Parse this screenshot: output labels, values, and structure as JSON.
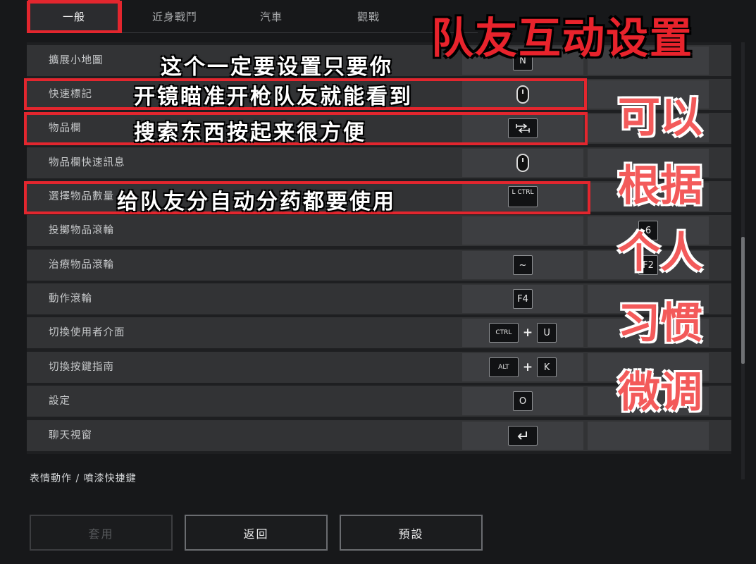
{
  "tabs": [
    {
      "label": "一般",
      "active": true
    },
    {
      "label": "近身戰鬥",
      "active": false
    },
    {
      "label": "汽車",
      "active": false
    },
    {
      "label": "觀戰",
      "active": false
    }
  ],
  "rows": [
    {
      "label": "擴展小地圖",
      "primary": "N"
    },
    {
      "label": "快速標記",
      "primary": "mouse-middle-icon"
    },
    {
      "label": "物品欄",
      "primary": "tab-key-icon"
    },
    {
      "label": "物品欄快速訊息",
      "primary": "mouse-icon"
    },
    {
      "label": "選擇物品數量",
      "primary": "L CTRL"
    },
    {
      "label": "投擲物品滾輪",
      "secondary": "6"
    },
    {
      "label": "治療物品滾輪",
      "primary": "~",
      "secondary": "F2"
    },
    {
      "label": "動作滾輪",
      "primary": "F4"
    },
    {
      "label": "切換使用者介面",
      "primary": [
        "CTRL",
        "U"
      ]
    },
    {
      "label": "切換按鍵指南",
      "primary": [
        "ALT",
        "K"
      ]
    },
    {
      "label": "設定",
      "primary": "O"
    },
    {
      "label": "聊天視窗",
      "primary": "enter-key-icon"
    }
  ],
  "keys": {
    "n": "N",
    "lctrl": "L CTRL",
    "six": "6",
    "tilde": "~",
    "f2": "F2",
    "f4": "F4",
    "ctrl": "CTRL",
    "u": "U",
    "alt": "ALT",
    "k": "K",
    "o": "O",
    "plus": "+"
  },
  "section_title": "表情動作 / 噴漆快捷鍵",
  "buttons": {
    "apply": "套用",
    "back": "返回",
    "default": "預設"
  },
  "overlay": {
    "headline": "队友互动设置",
    "caption_top_line1": "这个一定要设置只要你",
    "caption_top_line2": "开镜瞄准开枪队友就能看到",
    "caption_inventory": "搜索东西按起来很方便",
    "caption_quantity": "给队友分自动分药都要使用",
    "side_words": [
      "可以",
      "根据",
      "个人",
      "习惯",
      "微调"
    ]
  },
  "colors": {
    "highlight_red": "#e3262e",
    "side_text_red": "#f35a5a"
  }
}
